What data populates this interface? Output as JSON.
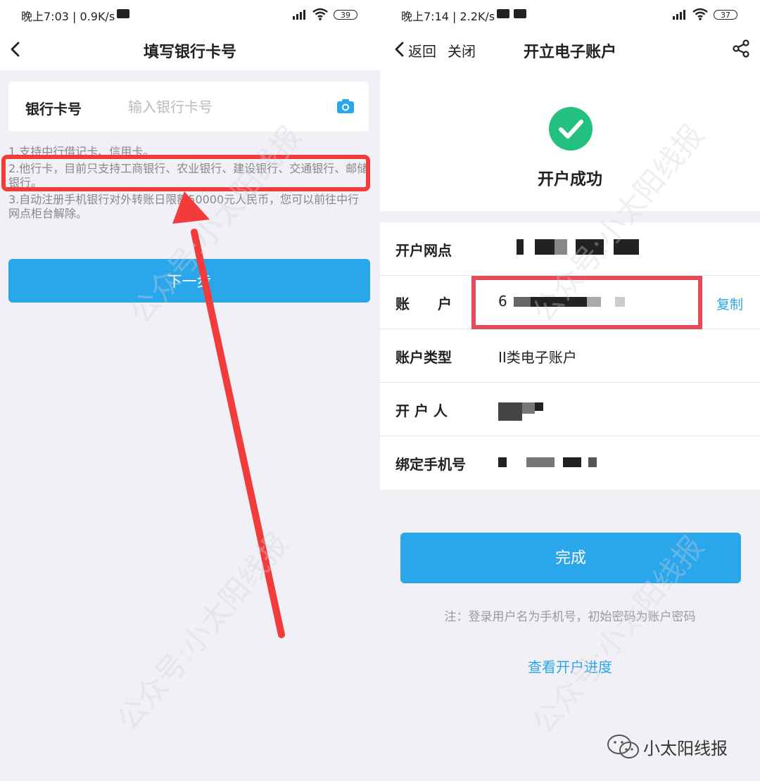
{
  "left": {
    "status": {
      "time": "晚上7:03 | 0.9K/s",
      "battery": "39"
    },
    "title": "填写银行卡号",
    "card_label": "银行卡号",
    "card_placeholder": "输入银行卡号",
    "notes": [
      "1.支持中行借记卡、信用卡。",
      "2.他行卡，目前只支持工商银行、农业银行、建设银行、交通银行、邮储银行。",
      "3.自动注册手机银行对外转账日限额50000元人民币，您可以前往中行网点柜台解除。"
    ],
    "next_button": "下一步"
  },
  "right": {
    "status": {
      "time": "晚上7:14 | 2.2K/s",
      "battery": "37"
    },
    "back": "返回",
    "close": "关闭",
    "title": "开立电子账户",
    "success": "开户成功",
    "rows": [
      {
        "label": "开户网点",
        "value": ""
      },
      {
        "label": "账　　户",
        "value": "6"
      },
      {
        "label": "账户类型",
        "value": "II类电子账户"
      },
      {
        "label": "开 户 人",
        "value": ""
      },
      {
        "label": "绑定手机号",
        "value": ""
      }
    ],
    "copy": "复制",
    "done_button": "完成",
    "footnote": "注：登录用户名为手机号，初始密码为账户密码",
    "progress_link": "查看开户进度"
  },
  "watermark": "公众号:小太阳线报",
  "brand": "小太阳线报",
  "colors": {
    "accent": "#2aa6ea",
    "success": "#24c07f",
    "highlight_red": "#f23c3c"
  }
}
